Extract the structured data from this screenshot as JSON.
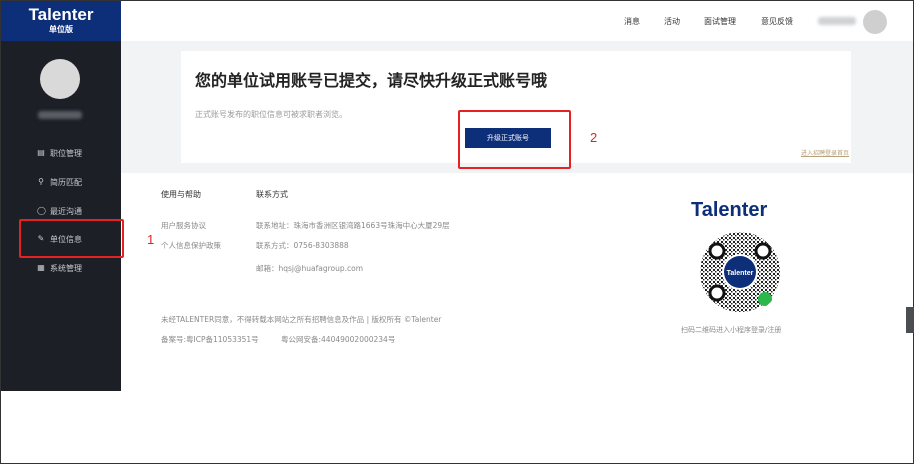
{
  "sidebar": {
    "brand": "Talenter",
    "brand_sub": "单位版",
    "items": [
      {
        "icon": "list-icon",
        "label": "职位管理"
      },
      {
        "icon": "search-icon",
        "label": "简历匹配"
      },
      {
        "icon": "chat-icon",
        "label": "最近沟通"
      },
      {
        "icon": "edit-icon",
        "label": "单位信息"
      },
      {
        "icon": "grid-icon",
        "label": "系统管理"
      }
    ]
  },
  "header": {
    "links": [
      "消息",
      "活动",
      "面试管理",
      "意见反馈"
    ]
  },
  "notice": {
    "title": "您的单位试用账号已提交，请尽快升级正式账号哦",
    "description": "正式账号发布的职位信息可被求职者浏览。",
    "upgrade_button": "升级正式账号",
    "small_link": "进入招聘登录首页"
  },
  "footer": {
    "help_heading": "使用与帮助",
    "help_links": [
      "用户服务协议",
      "个人信息保护政策"
    ],
    "contact_heading": "联系方式",
    "address": "联系地址：珠海市香洲区银湾路1663号珠海中心大厦29层",
    "phone": "联系方式：0756-8303888",
    "email": "邮箱：hqsj@huafagroup.com",
    "copyright": "未经TALENTER同意，不得转载本网站之所有招聘信息及作品 | 版权所有 ©Talenter",
    "icp": "备案号:粤ICP备11053351号",
    "police": "粤公网安备:44049002000234号",
    "qr_brand": "Talenter",
    "qr_center": "Talenter",
    "qr_caption": "扫码二维码进入小程序登录/注册"
  },
  "annotations": [
    "1",
    "2"
  ],
  "colors": {
    "brand": "#0d2f7a",
    "sidebar": "#1c1f26",
    "annotation": "#e52121"
  }
}
